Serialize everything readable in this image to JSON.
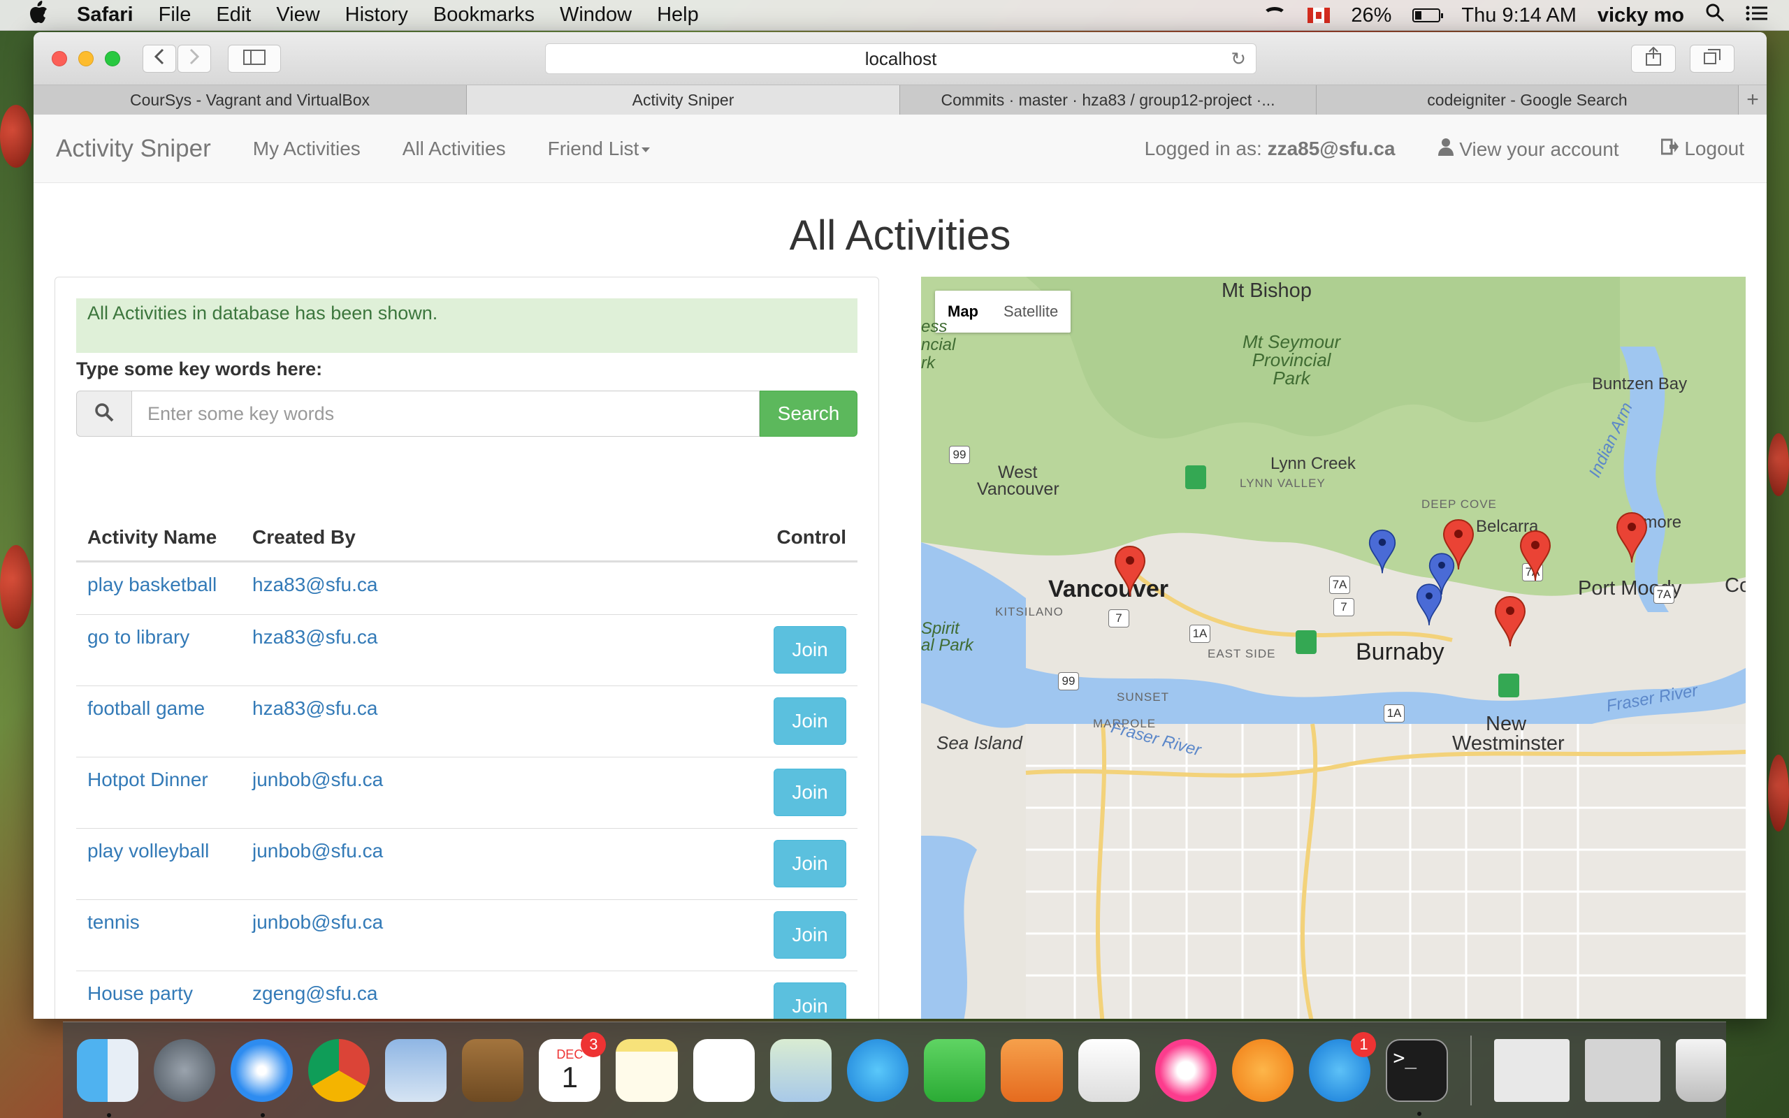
{
  "menubar": {
    "app_name": "Safari",
    "menus": [
      "File",
      "Edit",
      "View",
      "History",
      "Bookmarks",
      "Window",
      "Help"
    ],
    "battery": "26%",
    "clock": "Thu 9:14 AM",
    "user": "vicky mo"
  },
  "browser": {
    "address": "localhost",
    "tabs": [
      {
        "label": "CourSys - Vagrant and VirtualBox",
        "active": false
      },
      {
        "label": "Activity Sniper",
        "active": true
      },
      {
        "label": "Commits · master · hza83 / group12-project ·...",
        "active": false
      },
      {
        "label": "codeigniter - Google Search",
        "active": false
      }
    ],
    "new_tab": "+"
  },
  "navbar": {
    "brand": "Activity Sniper",
    "links": [
      "My Activities",
      "All Activities",
      "Friend List"
    ],
    "logged_in_prefix": "Logged in as:",
    "logged_in_user": "zza85@sfu.ca",
    "view_account": "View your account",
    "logout": "Logout"
  },
  "page": {
    "title": "All Activities",
    "alert": "All Activities in database has been shown.",
    "search_label": "Type some key words here:",
    "search_placeholder": "Enter some key words",
    "search_button": "Search"
  },
  "table": {
    "headers": {
      "name": "Activity Name",
      "creator": "Created By",
      "control": "Control"
    },
    "rows": [
      {
        "name": "play basketball",
        "creator": "hza83@sfu.ca",
        "action": ""
      },
      {
        "name": "go to library",
        "creator": "hza83@sfu.ca",
        "action": "Join"
      },
      {
        "name": "football game",
        "creator": "hza83@sfu.ca",
        "action": "Join"
      },
      {
        "name": "Hotpot Dinner",
        "creator": "junbob@sfu.ca",
        "action": "Join"
      },
      {
        "name": "play volleyball",
        "creator": "junbob@sfu.ca",
        "action": "Join"
      },
      {
        "name": "tennis",
        "creator": "junbob@sfu.ca",
        "action": "Join"
      },
      {
        "name": "House party",
        "creator": "zgeng@sfu.ca",
        "action": "Join"
      }
    ]
  },
  "map": {
    "type_map": "Map",
    "type_satellite": "Satellite",
    "labels": {
      "mt_bishop": "Mt Bishop",
      "mt_seymour_1": "Mt Seymour",
      "mt_seymour_2": "Provincial",
      "mt_seymour_3": "Park",
      "buntzen": "Buntzen Bay",
      "indian_arm": "Indian Arm",
      "lynn_creek": "Lynn Creek",
      "lynn_valley": "LYNN VALLEY",
      "west_van_1": "West",
      "west_van_2": "Vancouver",
      "deep_cove": "DEEP COVE",
      "belcarra": "Belcarra",
      "anmore": "Anmore",
      "vancouver": "Vancouver",
      "port_moody": "Port Moody",
      "kitsilano": "KITSILANO",
      "burnaby": "Burnaby",
      "east_side": "EAST SIDE",
      "sunset": "SUNSET",
      "marpole": "MARPOLE",
      "new_west_1": "New",
      "new_west_2": "Westminster",
      "sea_island": "Sea Island",
      "fraser_river": "Fraser River",
      "fraser_river_2": "Fraser River",
      "spirit_1": "Spirit",
      "spirit_2": "al Park",
      "ess": "ess",
      "ncial": "ncial",
      "rk": "rk",
      "co": "Co",
      "hw_99a": "99",
      "hw_99b": "99",
      "hw_7a_a": "7A",
      "hw_7a_b": "7A",
      "hw_7a_c": "7A",
      "hw_7_a": "7",
      "hw_7_b": "7",
      "hw_1a_a": "1A",
      "hw_1a_b": "1A"
    }
  },
  "dock": {
    "calendar_month": "DEC",
    "calendar_day": "1",
    "calendar_badge": "3",
    "appstore_badge": "1",
    "terminal_prompt": ">_"
  }
}
